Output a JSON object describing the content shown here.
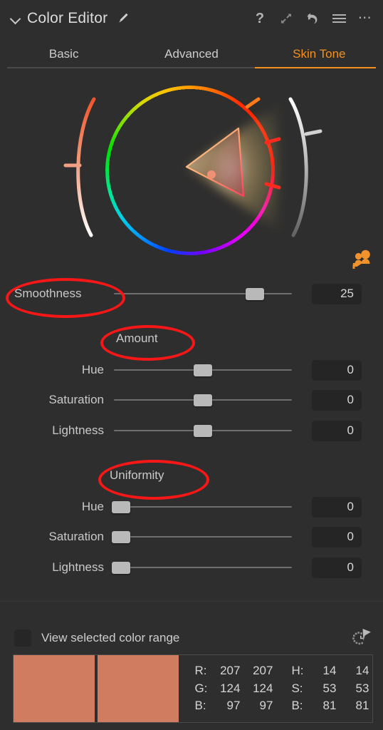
{
  "app": {
    "panel_title": "Color Editor",
    "collapse_icon": "chevron-down-icon",
    "brush_icon": "brush-picker-icon"
  },
  "header": {
    "icons": [
      {
        "name": "help-icon",
        "glyph": "?"
      },
      {
        "name": "expand-icon",
        "glyph": "⤢"
      },
      {
        "name": "reset-icon",
        "glyph": "↶"
      },
      {
        "name": "menu-icon",
        "glyph": "☰"
      },
      {
        "name": "more-options-icon",
        "glyph": "⋯"
      }
    ]
  },
  "tabs": [
    {
      "label": "Basic",
      "active": false
    },
    {
      "label": "Advanced",
      "active": false
    },
    {
      "label": "Skin Tone",
      "active": true
    }
  ],
  "color_wheel": {
    "skin_picker_icon": "skin-tone-picker-icon",
    "selection_dot_color": "#ee9074",
    "saturation_arc": {
      "from": "#f15a33",
      "to": "#ffffff"
    },
    "lightness_arc": {
      "from": "#ffffff",
      "to": "#6a6a6a"
    }
  },
  "smoothness": {
    "label": "Smoothness",
    "value": "25",
    "thumb_pct": 79
  },
  "amount": {
    "heading": "Amount",
    "sliders": [
      {
        "label": "Hue",
        "value": "0",
        "thumb_pct": 50
      },
      {
        "label": "Saturation",
        "value": "0",
        "thumb_pct": 50
      },
      {
        "label": "Lightness",
        "value": "0",
        "thumb_pct": 50
      }
    ]
  },
  "uniformity": {
    "heading": "Uniformity",
    "sliders": [
      {
        "label": "Hue",
        "value": "0",
        "thumb_pct": 4
      },
      {
        "label": "Saturation",
        "value": "0",
        "thumb_pct": 4
      },
      {
        "label": "Lightness",
        "value": "0",
        "thumb_pct": 4
      }
    ]
  },
  "view_range": {
    "label": "View selected color range",
    "checked": false,
    "marquee_icon": "selection-cursor-icon"
  },
  "swatches": {
    "before_color": "#cf7c61",
    "after_color": "#cf7c61"
  },
  "readout": {
    "rows": [
      {
        "key": "R:",
        "v1": "207",
        "v2": "207",
        "key2": "H:",
        "v3": "14",
        "v4": "14"
      },
      {
        "key": "G:",
        "v1": "124",
        "v2": "124",
        "key2": "S:",
        "v3": "53",
        "v4": "53"
      },
      {
        "key": "B:",
        "v1": "97",
        "v2": "97",
        "key2": "B:",
        "v3": "81",
        "v4": "81"
      }
    ]
  },
  "annotations": {
    "accent_color": "#f71717",
    "items": [
      {
        "target": "Smoothness"
      },
      {
        "target": "Amount"
      },
      {
        "target": "Uniformity"
      }
    ]
  }
}
